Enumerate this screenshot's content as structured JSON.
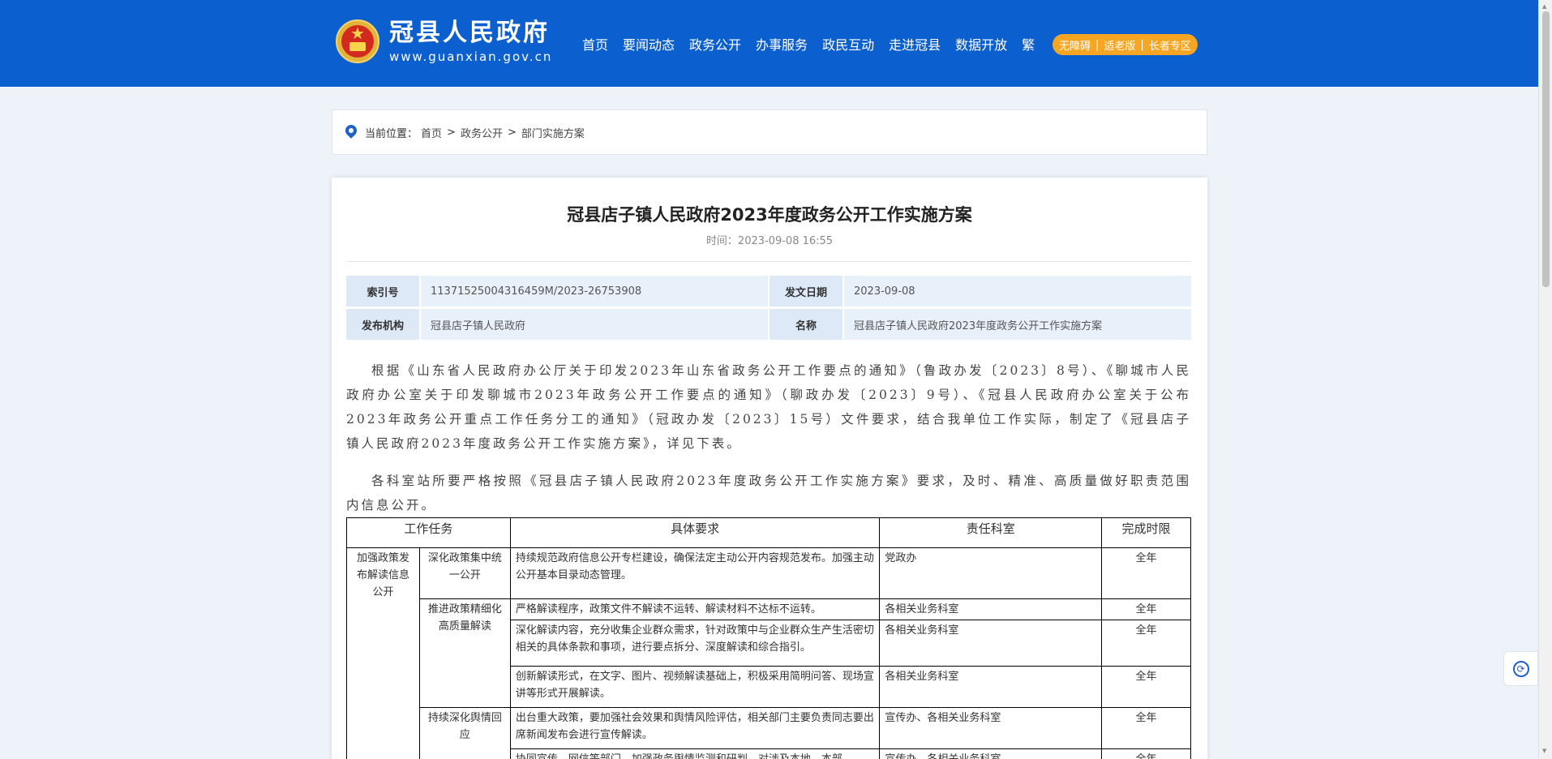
{
  "header": {
    "site_title": "冠县人民政府",
    "site_url": "www.guanxian.gov.cn",
    "nav": [
      "首页",
      "要闻动态",
      "政务公开",
      "办事服务",
      "政民互动",
      "走进冠县",
      "数据开放",
      "繁"
    ],
    "access": [
      "无障碍",
      "适老版",
      "长者专区"
    ],
    "colors": {
      "header_bg": "#0b5fcf",
      "access_bg": "#f6a623"
    }
  },
  "breadcrumb": {
    "label": "当前位置：",
    "items": [
      "首页",
      "政务公开",
      "部门实施方案"
    ],
    "separator": ">"
  },
  "article": {
    "title": "冠县店子镇人民政府2023年度政务公开工作实施方案",
    "time_label": "时间：",
    "time": "2023-09-08 16:55",
    "meta": {
      "index_label": "索引号",
      "index_value": "11371525004316459M/2023-26753908",
      "date_label": "发文日期",
      "date_value": "2023-09-08",
      "org_label": "发布机构",
      "org_value": "冠县店子镇人民政府",
      "name_label": "名称",
      "name_value": "冠县店子镇人民政府2023年度政务公开工作实施方案"
    },
    "para1": "根据《山东省人民政府办公厅关于印发2023年山东省政务公开工作要点的通知》（鲁政办发〔2023〕8号）、《聊城市人民政府办公室关于印发聊城市2023年政务公开工作要点的通知》（聊政办发〔2023〕9号）、《冠县人民政府办公室关于公布2023年政务公开重点工作任务分工的通知》（冠政办发〔2023〕15号）文件要求，结合我单位工作实际，制定了《冠县店子镇人民政府2023年度政务公开工作实施方案》，详见下表。",
    "para2": "各科室站所要严格按照《冠县店子镇人民政府2023年度政务公开工作实施方案》要求，及时、精准、高质量做好职责范围内信息公开。"
  },
  "table": {
    "headers": [
      "工作任务",
      "具体要求",
      "责任科室",
      "完成时限"
    ],
    "rows": [
      {
        "task": "加强政策发布解读信息公开",
        "subtask": "深化政策集中统一公开",
        "req": "持续规范政府信息公开专栏建设，确保法定主动公开内容规范发布。加强主动公开基本目录动态管理。",
        "dept": "党政办",
        "limit": "全年"
      },
      {
        "subtask": "推进政策精细化高质量解读",
        "req": "严格解读程序，政策文件不解读不运转、解读材料不达标不运转。",
        "dept": "各相关业务科室",
        "limit": "全年"
      },
      {
        "req": "深化解读内容，充分收集企业群众需求，针对政策中与企业群众生产生活密切相关的具体条款和事项，进行要点拆分、深度解读和综合指引。",
        "dept": "各相关业务科室",
        "limit": "全年"
      },
      {
        "req": "创新解读形式，在文字、图片、视频解读基础上，积极采用简明问答、现场宣讲等形式开展解读。",
        "dept": "各相关业务科室",
        "limit": "全年"
      },
      {
        "subtask": "持续深化舆情回应",
        "req": "出台重大政策，要加强社会效果和舆情风险评估，相关部门主要负责同志要出席新闻发布会进行宣传解读。",
        "dept": "宣传办、各相关业务科室",
        "limit": "全年"
      },
      {
        "req": "协同宣传、网信等部门，加强政务舆情监测和研判，对涉及本地、本部",
        "dept": "宣传办、各相关业务科室",
        "limit": "全年"
      }
    ]
  }
}
